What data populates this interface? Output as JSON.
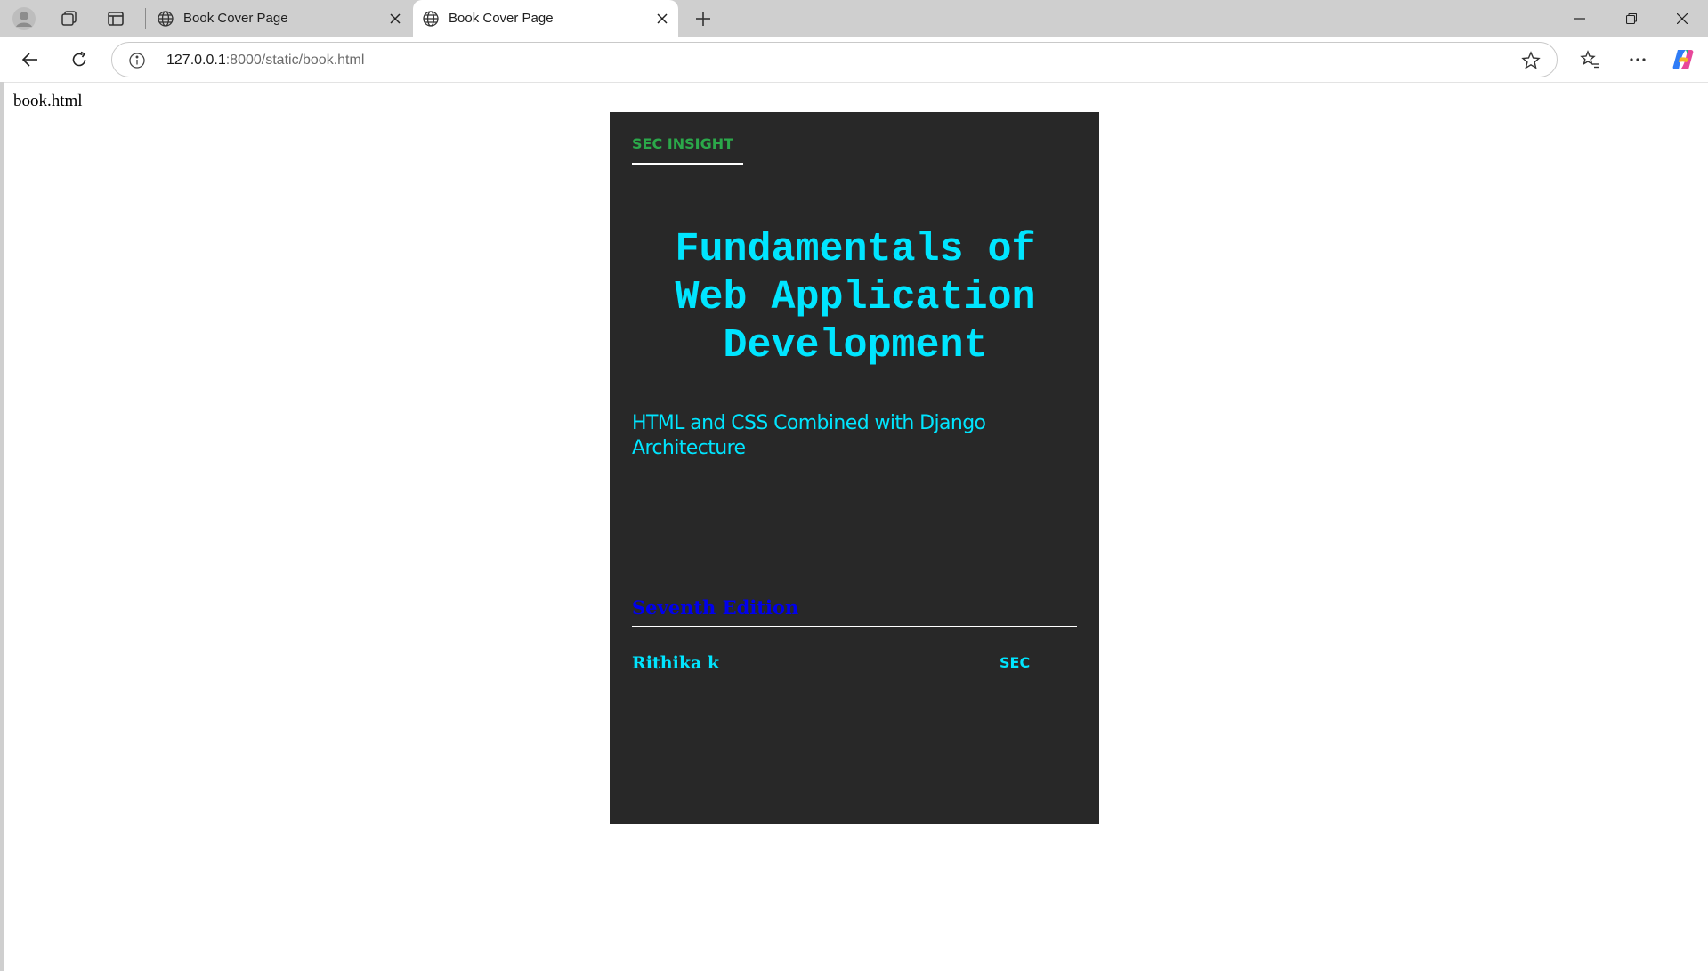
{
  "browser": {
    "tabs": [
      {
        "title": "Book Cover Page",
        "active": false
      },
      {
        "title": "Book Cover Page",
        "active": true
      }
    ],
    "address_bar": {
      "url_host": "127.0.0.1",
      "url_rest": ":8000/static/book.html"
    },
    "icons": {
      "profile": "profile-icon",
      "workspaces": "workspaces-icon",
      "tab_actions": "tab-actions-icon",
      "favicon": "globe-icon",
      "close_tab": "close-icon",
      "new_tab": "plus-icon",
      "minimize": "minimize-icon",
      "maximize": "restore-icon",
      "close_window": "close-icon",
      "back": "back-arrow-icon",
      "refresh": "refresh-icon",
      "site_info": "info-icon",
      "favorite": "star-icon",
      "favorites_bar": "favorites-icon",
      "more": "more-icon",
      "copilot": "copilot-icon"
    }
  },
  "page": {
    "label": "book.html",
    "cover": {
      "background": "#282828",
      "publisher": "SEC INSIGHT",
      "title": "Fundamentals of Web Application Development",
      "subtitle": "HTML and CSS Combined with Django Architecture",
      "edition": "Seventh Edition",
      "author": "Rithika k",
      "imprint": "SEC",
      "colors": {
        "publisher": "#2ba84a",
        "title": "#00e5ff",
        "edition": "#0000ee"
      }
    }
  }
}
